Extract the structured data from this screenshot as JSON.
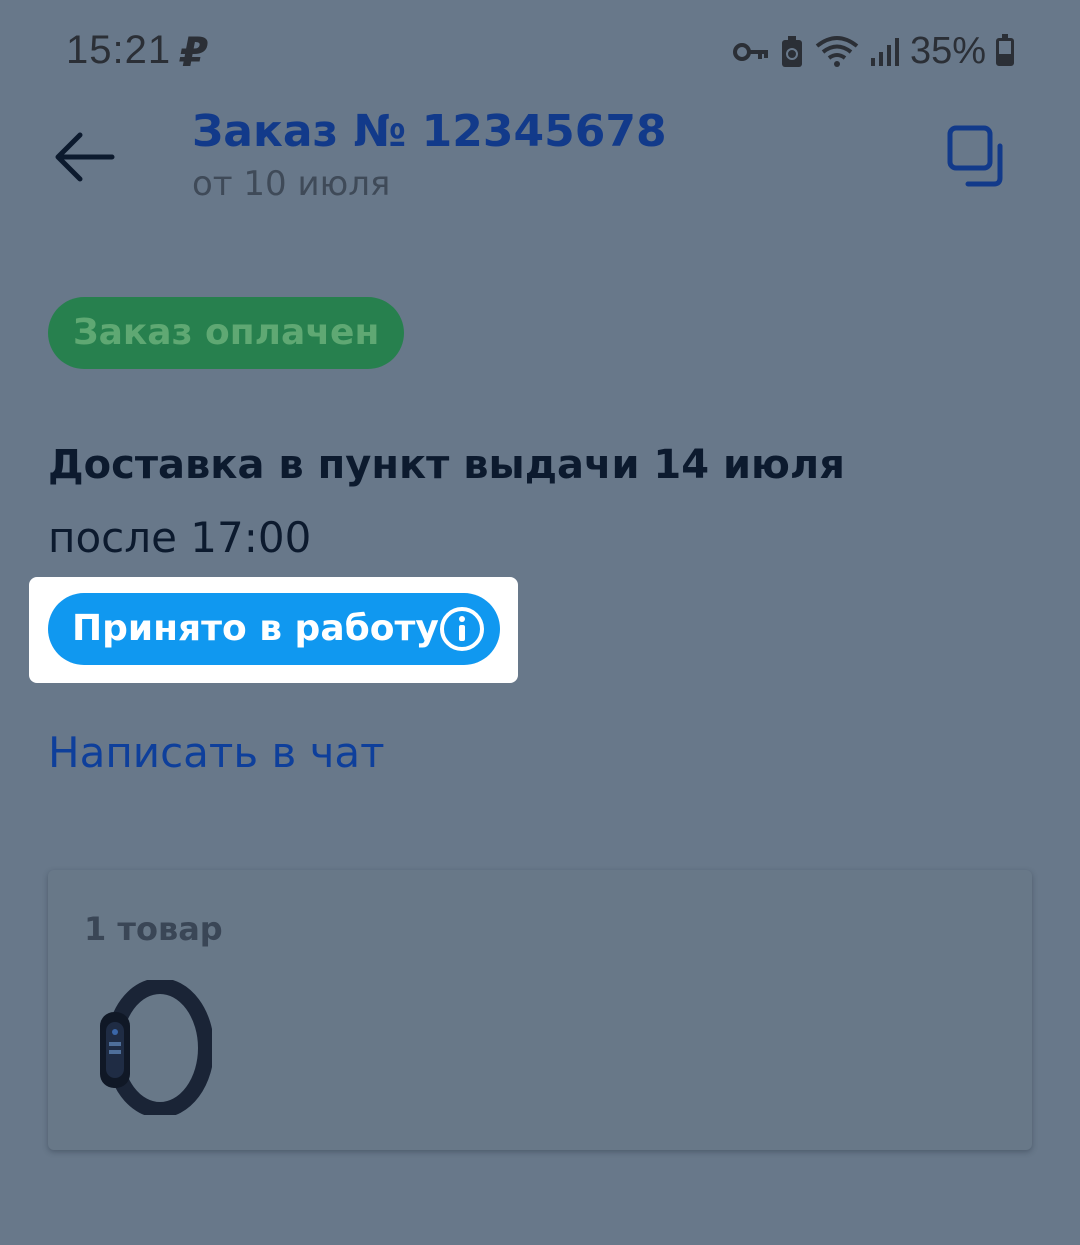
{
  "status_bar": {
    "time": "15:21",
    "carrier_icon": "ruble-p-icon",
    "battery": "35%"
  },
  "header": {
    "title": "Заказ № 12345678",
    "subtitle": "от 10 июля"
  },
  "order": {
    "payment_status": "Заказ оплачен",
    "delivery_text": "Доставка в пункт выдачи 14 июля",
    "delivery_time": "после 17:00",
    "work_status": "Принято в работу",
    "chat_link": "Написать в чат"
  },
  "items": {
    "count_label": "1 товар"
  },
  "colors": {
    "accent_blue": "#1098f0",
    "title_blue": "#123a8a",
    "paid_green": "#27804e",
    "overlay": "#68788a"
  }
}
